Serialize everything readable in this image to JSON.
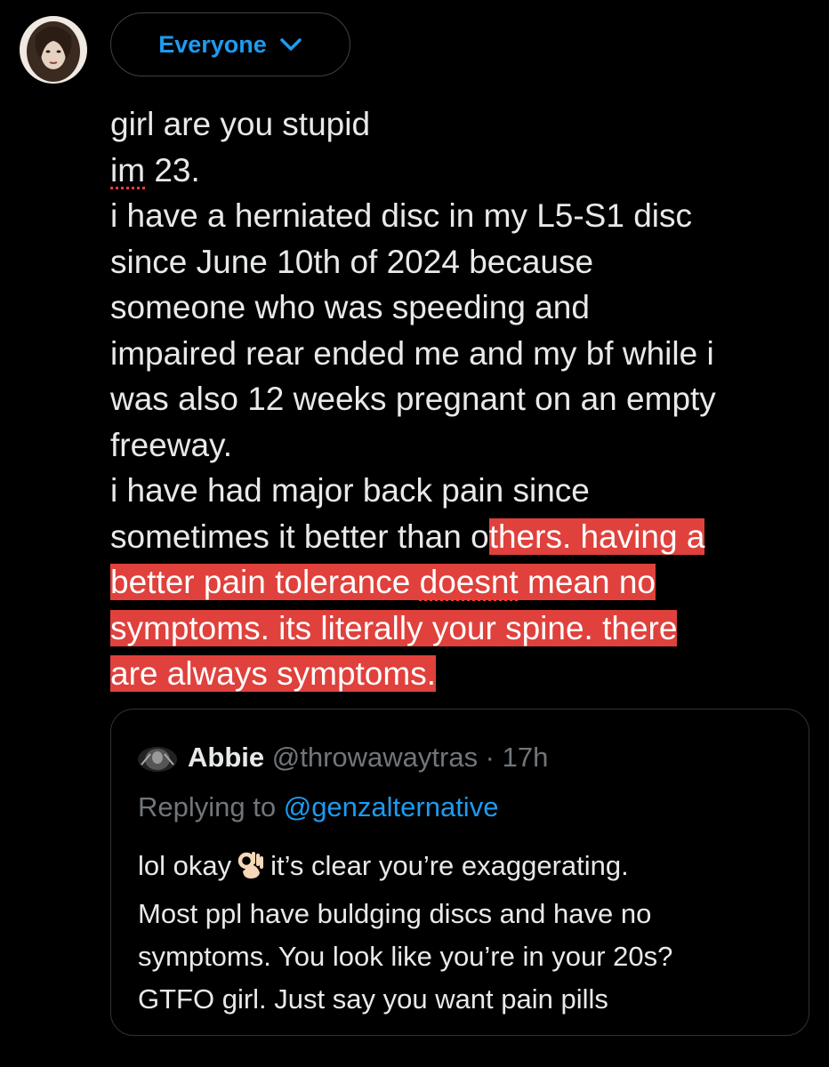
{
  "header": {
    "audience_label": "Everyone",
    "avatar_icon": "profile-photo-avatar",
    "chevron_icon": "chevron-down-icon"
  },
  "tweet": {
    "lines": [
      "girl are you stupid",
      "23.",
      "i have a herniated disc in my L5-S1 disc",
      "since June 10th of 2024 because",
      "someone who was speeding and",
      "impaired rear ended me and my bf while i",
      "was also 12 weeks pregnant on an empty",
      "freeway.",
      "i have had major back pain since",
      "sometimes it better than o",
      "thers. having a",
      "better pain tolerance ",
      "doesnt",
      " mean no",
      "symptoms. its literally your spine. there",
      "are always symptoms."
    ],
    "misspelled_word": "im",
    "highlight_color": "#e0413c"
  },
  "quoted": {
    "name": "Abbie",
    "handle_time": "@throwawaytras · 17h",
    "replying_prefix": "Replying to",
    "replying_mention": "@genzalternative",
    "line1_start": "lol okay",
    "emoji_icon": "ok-hand-emoji",
    "line1_end": "it’s clear you’re exaggerating.",
    "lines": [
      "Most ppl have buldging discs and have no",
      "symptoms. You look like you’re in your 20s?",
      "GTFO girl. Just say you want pain pills"
    ]
  },
  "colors": {
    "background": "#000000",
    "text": "#e7e9ea",
    "accent": "#1d9bf0",
    "muted": "#71767b"
  }
}
